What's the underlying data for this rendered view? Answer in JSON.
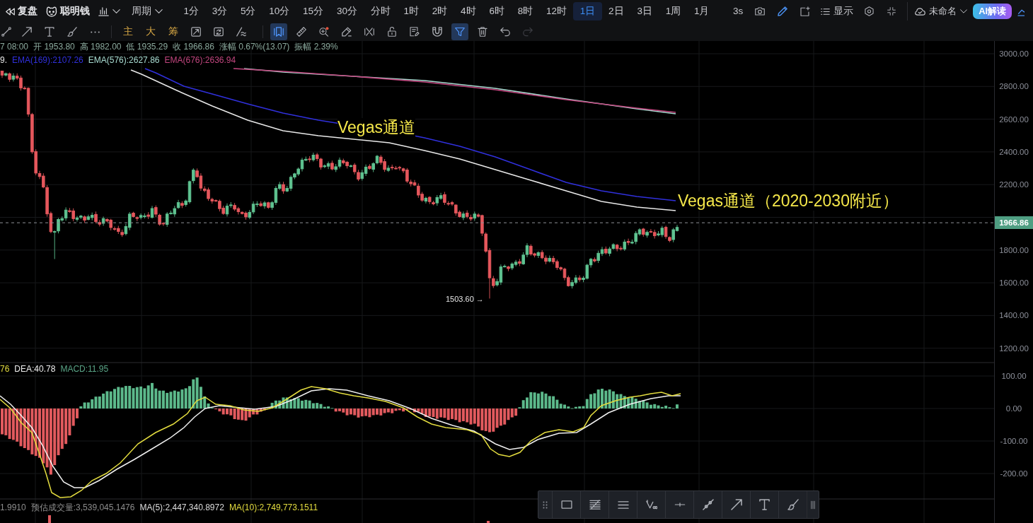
{
  "top_bar": {
    "replay_label": "复盘",
    "smart_money_label": "聪明钱",
    "period_label": "周期",
    "intervals": [
      {
        "label": "1分",
        "selected": false
      },
      {
        "label": "3分",
        "selected": false
      },
      {
        "label": "5分",
        "selected": false
      },
      {
        "label": "10分",
        "selected": false
      },
      {
        "label": "15分",
        "selected": false
      },
      {
        "label": "30分",
        "selected": false
      },
      {
        "label": "分时",
        "selected": false
      },
      {
        "label": "1时",
        "selected": false
      },
      {
        "label": "2时",
        "selected": false
      },
      {
        "label": "4时",
        "selected": false
      },
      {
        "label": "6时",
        "selected": false
      },
      {
        "label": "8时",
        "selected": false
      },
      {
        "label": "12时",
        "selected": false
      },
      {
        "label": "1日",
        "selected": true
      },
      {
        "label": "2日",
        "selected": false
      },
      {
        "label": "3日",
        "selected": false
      },
      {
        "label": "1周",
        "selected": false
      },
      {
        "label": "1月",
        "selected": false
      }
    ],
    "refresh_label": "3s",
    "display_label": "显示",
    "layout_name": "未命名",
    "ai_label": "AI解读"
  },
  "drawing_toolbar": {
    "groups": [
      [
        {
          "kind": "icon",
          "selected": false,
          "disabled": false
        },
        {
          "kind": "icon",
          "selected": false,
          "disabled": false
        },
        {
          "kind": "icon",
          "selected": false,
          "disabled": false
        },
        {
          "kind": "icon",
          "selected": false,
          "disabled": false
        },
        {
          "kind": "icon",
          "selected": false,
          "disabled": false
        }
      ],
      [
        {
          "kind": "text",
          "label": "主",
          "selected": false,
          "disabled": false
        },
        {
          "kind": "text",
          "label": "大",
          "selected": false,
          "disabled": false
        },
        {
          "kind": "text",
          "label": "筹",
          "selected": false,
          "disabled": false
        },
        {
          "kind": "icon",
          "selected": false,
          "disabled": false
        },
        {
          "kind": "icon",
          "selected": false,
          "disabled": false
        },
        {
          "kind": "icon",
          "selected": false,
          "disabled": false
        }
      ],
      [
        {
          "kind": "icon",
          "selected": true,
          "disabled": false
        },
        {
          "kind": "icon",
          "selected": false,
          "disabled": false
        },
        {
          "kind": "icon",
          "selected": false,
          "disabled": false
        },
        {
          "kind": "icon",
          "selected": false,
          "disabled": false
        },
        {
          "kind": "icon",
          "selected": false,
          "disabled": false
        },
        {
          "kind": "icon",
          "selected": false,
          "disabled": false
        },
        {
          "kind": "icon",
          "selected": false,
          "disabled": false
        },
        {
          "kind": "icon",
          "selected": false,
          "disabled": false
        },
        {
          "kind": "icon",
          "selected": true,
          "disabled": false
        },
        {
          "kind": "icon",
          "selected": false,
          "disabled": false
        },
        {
          "kind": "icon",
          "selected": false,
          "disabled": false
        },
        {
          "kind": "icon",
          "selected": false,
          "disabled": true
        }
      ]
    ]
  },
  "chart": {
    "ohlc_legend": [
      "7 08:00",
      "开 1953.80",
      "高 1982.00",
      "低 1935.29",
      "收 1966.86",
      "涨幅 0.67%(13.07)",
      "振幅 2.39%"
    ],
    "ema_legend": [
      {
        "label": "9.",
        "color": "#e8e8e8"
      },
      {
        "label": "EMA(169):2107.26",
        "color": "#3030dc"
      },
      {
        "label": "EMA(576):2627.86",
        "color": "#a9dcd2"
      },
      {
        "label": "EMA(676):2636.94",
        "color": "#c2467f"
      }
    ],
    "annotations": [
      "Vegas通道",
      "Vegas通道（2020-2030附近）"
    ],
    "low_label": "1503.60 →",
    "price_axis": [
      "3000.00",
      "2800.00",
      "2600.00",
      "2400.00",
      "2200.00",
      "1800.00",
      "1600.00",
      "1400.00",
      "1200.00"
    ],
    "last_price": "1966.86",
    "macd_legend": [
      {
        "label": "76",
        "color": "#e3dc3f"
      },
      {
        "label": "DEA:40.78",
        "color": "#f0f0f0"
      },
      {
        "label": "MACD:11.95",
        "color": "#5aa587"
      }
    ],
    "macd_axis": [
      "100.00",
      "0.00",
      "-100.00",
      "-200.00"
    ],
    "volume_legend": [
      {
        "label": "1.9910",
        "color": "#8c8c8c"
      },
      {
        "label": "预估成交量:3,539,045.1476",
        "color": "#8c8c8c"
      },
      {
        "label": "MA(5):2,447,340.8972",
        "color": "#dcdcdc"
      },
      {
        "label": "MA(10):2,749,773.1511",
        "color": "#e3dc3f"
      }
    ]
  }
}
